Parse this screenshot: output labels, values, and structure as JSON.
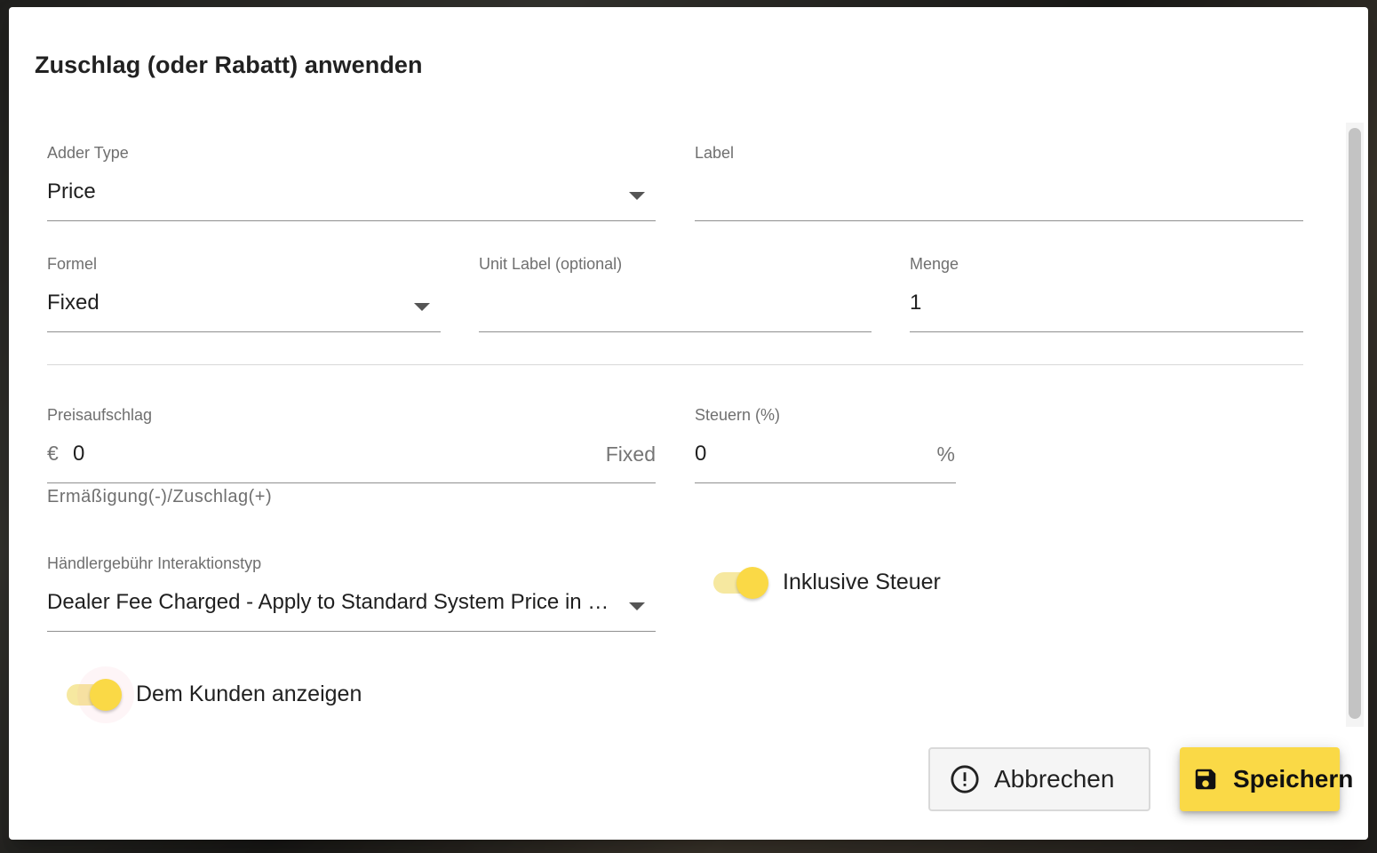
{
  "dialog": {
    "title": "Zuschlag (oder Rabatt) anwenden"
  },
  "fields": {
    "adder_type": {
      "label": "Adder Type",
      "value": "Price"
    },
    "label": {
      "label": "Label",
      "value": ""
    },
    "formula": {
      "label": "Formel",
      "value": "Fixed"
    },
    "unit_label": {
      "label": "Unit Label (optional)",
      "value": ""
    },
    "quantity": {
      "label": "Menge",
      "value": "1"
    },
    "price_adder": {
      "label": "Preisaufschlag",
      "prefix": "€",
      "value": "0",
      "suffix": "Fixed",
      "helper": "Ermäßigung(-)/Zuschlag(+)"
    },
    "tax": {
      "label": "Steuern (%)",
      "value": "0",
      "suffix": "%"
    },
    "dealer_fee": {
      "label": "Händlergebühr Interaktionstyp",
      "value": "Dealer Fee Charged - Apply to Standard System Price in Pricing"
    }
  },
  "toggles": {
    "include_tax": {
      "label": "Inklusive Steuer",
      "checked": true
    },
    "show_customer": {
      "label": "Dem Kunden anzeigen",
      "checked": true
    }
  },
  "actions": {
    "cancel_label": "Abbrechen",
    "save_label": "Speichern"
  },
  "icons": {
    "dropdown": "arrow-drop-down-icon",
    "cancel": "alert-circle-icon",
    "save": "floppy-disk-icon"
  },
  "colors": {
    "accent": "#fad946",
    "accent_track": "#f6e8a0",
    "text": "#212121",
    "label": "#6f6f6f"
  }
}
